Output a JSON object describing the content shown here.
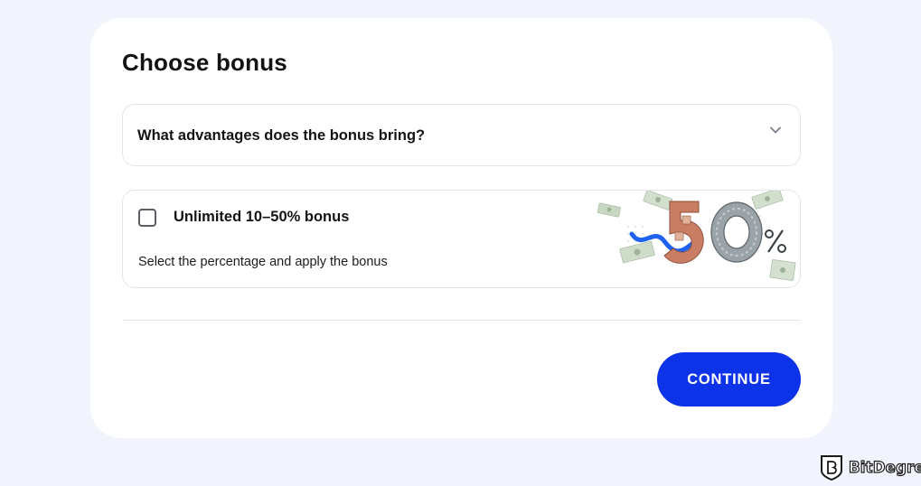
{
  "dialog": {
    "title": "Choose bonus"
  },
  "faq": {
    "question": "What advantages does the bonus bring?",
    "expand_icon": "chevron-down-icon",
    "expanded": false
  },
  "bonus_option": {
    "name": "Unlimited 10–50% bonus",
    "description": "Select the percentage and apply the bonus",
    "checked": false,
    "illustration": "bonus-50-percent-money-illustration"
  },
  "actions": {
    "continue_label": "CONTINUE"
  },
  "watermark": {
    "text": "BitDegree",
    "logo_icon": "bitdegree-shield-logo"
  },
  "colors": {
    "page_background": "#f1f4fd",
    "card_background": "#ffffff",
    "primary_button": "#0d33e8",
    "border": "#e3e5ea"
  }
}
